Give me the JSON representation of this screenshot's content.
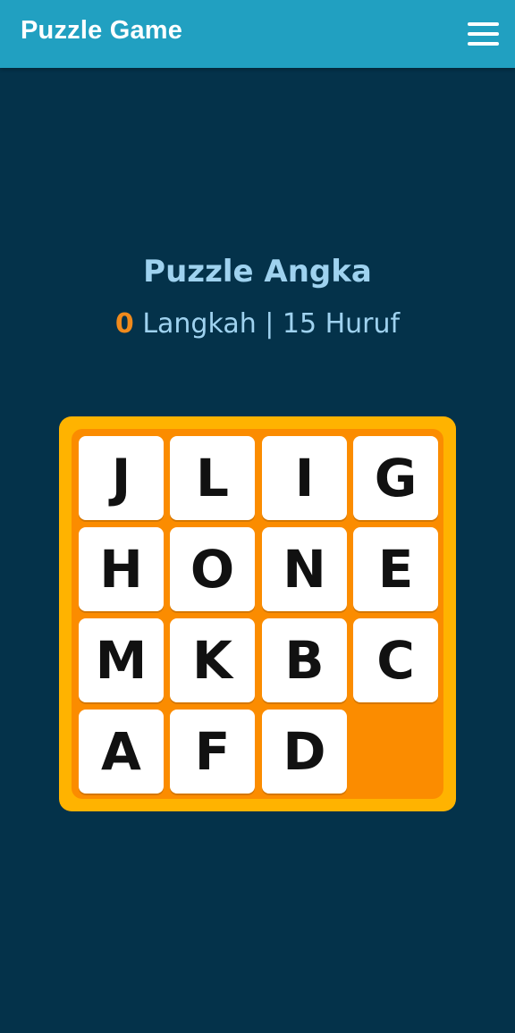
{
  "appbar": {
    "title": "Puzzle Game",
    "menu_icon": "hamburger-menu-icon"
  },
  "game": {
    "title": "Puzzle Angka",
    "moves": "0",
    "stats_suffix": " Langkah | 15 Huruf"
  },
  "colors": {
    "appbar": "#21a0c1",
    "background": "#04324a",
    "board_frame": "#ffb300",
    "board_inner": "#fb8c00",
    "moves": "#f08a1c",
    "text": "#9fd2ef"
  },
  "board": {
    "rows": [
      [
        "J",
        "L",
        "I",
        "G"
      ],
      [
        "H",
        "O",
        "N",
        "E"
      ],
      [
        "M",
        "K",
        "B",
        "C"
      ],
      [
        "A",
        "F",
        "D",
        ""
      ]
    ]
  }
}
